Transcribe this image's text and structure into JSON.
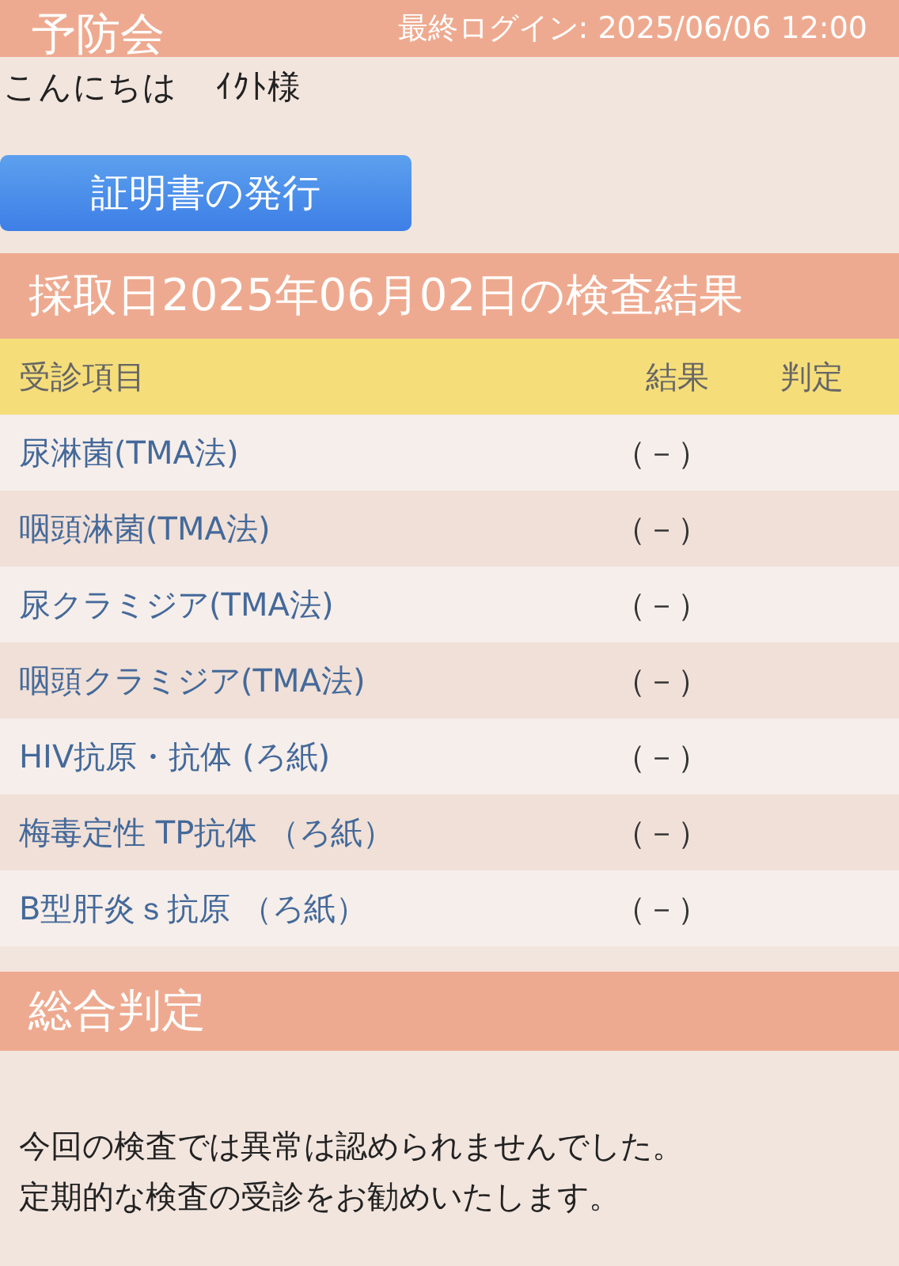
{
  "header": {
    "title": "予防会",
    "last_login": "最終ログイン: 2025/06/06 12:00"
  },
  "greeting": {
    "text": "こんにちは",
    "name": "ｲｸﾄ様"
  },
  "certificate_button": "証明書の発行",
  "results": {
    "title": "採取日2025年06月02日の検査結果",
    "columns": [
      "受診項目",
      "結果",
      "判定"
    ],
    "rows": [
      {
        "item": "尿淋菌(TMA法)",
        "result": "（－）"
      },
      {
        "item": "咽頭淋菌(TMA法)",
        "result": "（－）"
      },
      {
        "item": "尿クラミジア(TMA法)",
        "result": "（－）"
      },
      {
        "item": "咽頭クラミジア(TMA法)",
        "result": "（－）"
      },
      {
        "item": "HIV抗原・抗体 (ろ紙)",
        "result": "（－）"
      },
      {
        "item": "梅毒定性 TP抗体 （ろ紙）",
        "result": "（－）"
      },
      {
        "item": "B型肝炎ｓ抗原 （ろ紙）",
        "result": "（－）"
      }
    ]
  },
  "summary": {
    "title": "総合判定",
    "lines": [
      "今回の検査では異常は認められませんでした。",
      "定期的な検査の受診をお勧めいたします。"
    ]
  }
}
